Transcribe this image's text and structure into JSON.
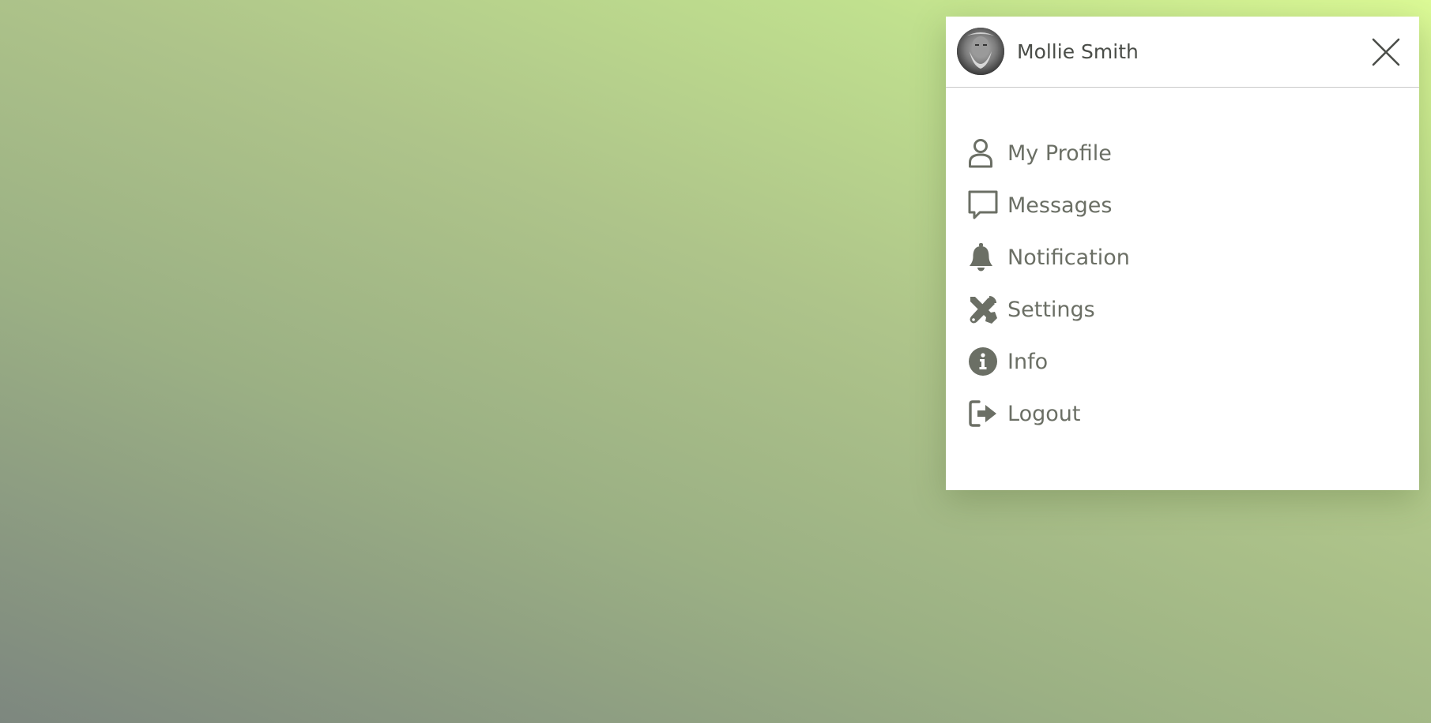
{
  "theme": {
    "icon_color": "#6b6f65",
    "text_color": "#6b6f65",
    "name_color": "#4a4d48",
    "panel_bg": "#ffffff"
  },
  "user": {
    "name": "Mollie Smith",
    "avatar": "avatar-photo"
  },
  "header": {
    "close_icon": "close-icon"
  },
  "menu": {
    "items": [
      {
        "label": "My Profile",
        "icon": "user-icon"
      },
      {
        "label": "Messages",
        "icon": "chat-bubble-icon"
      },
      {
        "label": "Notification",
        "icon": "bell-icon"
      },
      {
        "label": "Settings",
        "icon": "tools-icon"
      },
      {
        "label": "Info",
        "icon": "info-icon"
      },
      {
        "label": "Logout",
        "icon": "logout-icon"
      }
    ]
  }
}
